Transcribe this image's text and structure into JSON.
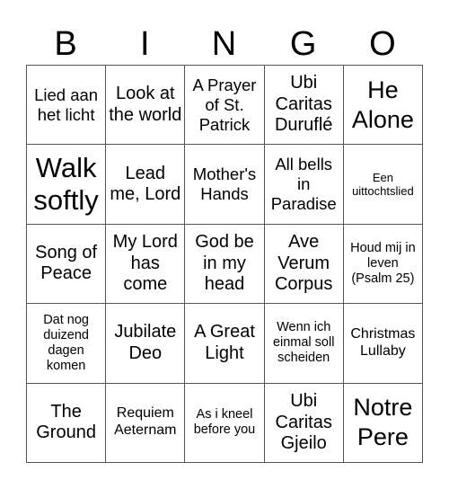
{
  "header": {
    "letters": [
      "B",
      "I",
      "N",
      "G",
      "O"
    ]
  },
  "board": {
    "rows": [
      [
        "Lied aan het licht",
        "Look at the world",
        "A Prayer of St. Patrick",
        "Ubi Caritas Duruflé",
        "He Alone"
      ],
      [
        "Walk softly",
        "Lead me, Lord",
        "Mother's Hands",
        "All bells in Paradise",
        "Een uittochtslied"
      ],
      [
        "Song of Peace",
        "My Lord has come",
        "God be in my head",
        "Ave Verum Corpus",
        "Houd mij in leven (Psalm 25)"
      ],
      [
        "Dat nog duizend dagen komen",
        "Jubilate Deo",
        "A Great Light",
        "Wenn ich einmal soll scheiden",
        "Christmas Lullaby"
      ],
      [
        "The Ground",
        "Requiem Aeternam",
        "As i kneel before you",
        "Ubi Caritas Gjeilo",
        "Notre Pere"
      ]
    ]
  }
}
